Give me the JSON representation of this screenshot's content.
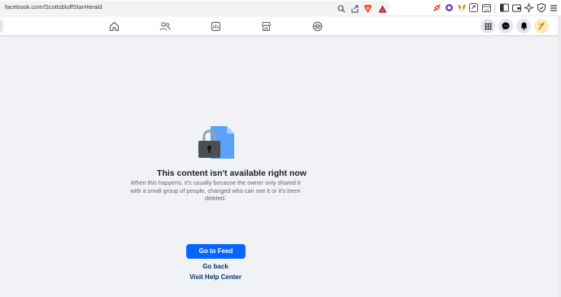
{
  "browser": {
    "url": "facebook.com/ScottsbluffStarHerald",
    "url_buttons": [
      "zoom-icon",
      "share-icon",
      "brave-shields-icon",
      "brave-rewards-icon"
    ],
    "extensions": [
      "extension-link-icon",
      "extension-purple-icon",
      "metamask-icon",
      "extension-arrows-icon",
      "extension-calendar-icon",
      "sidebar-icon",
      "wallet-icon",
      "leo-ai-icon",
      "vpn-shield-icon",
      "menu-icon"
    ]
  },
  "fb_nav": {
    "tabs": [
      "home-icon",
      "friends-icon",
      "video-icon",
      "marketplace-icon",
      "groups-icon"
    ],
    "right": [
      "menu-grid-icon",
      "messenger-icon",
      "notifications-icon",
      "account-avatar"
    ]
  },
  "error": {
    "title": "This content isn't available right now",
    "description": "When this happens, it's usually because the owner only shared it with a small group of people, changed who can see it or it's been deleted.",
    "primary_button": "Go to Feed",
    "back_link": "Go back",
    "help_link": "Visit Help Center"
  },
  "colors": {
    "primary": "#0866ff",
    "link": "#0a2f6e",
    "background": "#f0f2f5"
  }
}
